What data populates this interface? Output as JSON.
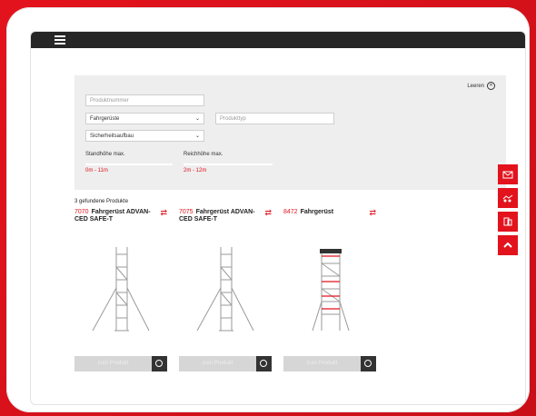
{
  "header": {
    "menu_icon": "hamburger-icon"
  },
  "filter": {
    "clear_label": "Leeren",
    "product_number_placeholder": "Produktnummer",
    "category_value": "Fahrgerüste",
    "product_type_placeholder": "Produkttyp",
    "type_value": "Sicherheitsaufbau",
    "standing_height_label": "Standhöhe max.",
    "standing_height_range": "0m - 11m",
    "reach_height_label": "Reichhöhe max.",
    "reach_height_range": "2m - 12m"
  },
  "results": {
    "count_label": "3 gefundene Produkte",
    "products": [
      {
        "number": "7070",
        "name": "Fahrgerüst ADVAN-CED SAFE-T",
        "button": "zum Produkt"
      },
      {
        "number": "7075",
        "name": "Fahrgerüst ADVAN-CED SAFE-T",
        "button": "zum Produkt"
      },
      {
        "number": "8472",
        "name": "Fahrgerüst",
        "button": "zum Produkt"
      }
    ]
  },
  "side_buttons": [
    "contact-icon",
    "handshake-icon",
    "catalog-icon",
    "scroll-up-icon"
  ],
  "colors": {
    "accent": "#e3131d",
    "topbar": "#262626",
    "panel": "#eeeeee"
  }
}
